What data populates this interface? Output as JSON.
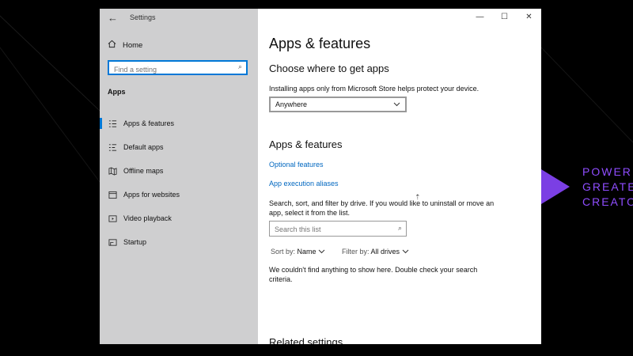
{
  "promo": {
    "text": "POWERI\nGREATE\nCREATO",
    "color": "#8f4dff"
  },
  "window": {
    "title": "Settings",
    "controls": {
      "minimize": "—",
      "maximize": "☐",
      "close": "✕"
    }
  },
  "sidebar": {
    "home": "Home",
    "search_placeholder": "Find a setting",
    "section": "Apps",
    "items": [
      {
        "label": "Apps & features",
        "icon": "apps-features-icon",
        "active": true
      },
      {
        "label": "Default apps",
        "icon": "default-apps-icon",
        "active": false
      },
      {
        "label": "Offline maps",
        "icon": "offline-maps-icon",
        "active": false
      },
      {
        "label": "Apps for websites",
        "icon": "apps-websites-icon",
        "active": false
      },
      {
        "label": "Video playback",
        "icon": "video-playback-icon",
        "active": false
      },
      {
        "label": "Startup",
        "icon": "startup-icon",
        "active": false
      }
    ]
  },
  "main": {
    "title": "Apps & features",
    "choose_heading": "Choose where to get apps",
    "choose_desc": "Installing apps only from Microsoft Store helps protect your device.",
    "source_value": "Anywhere",
    "apps_heading": "Apps & features",
    "link_optional": "Optional features",
    "link_aliases": "App execution aliases",
    "search_desc": "Search, sort, and filter by drive. If you would like to uninstall or move an app, select it from the list.",
    "search_placeholder": "Search this list",
    "sort_label": "Sort by:",
    "sort_value": "Name",
    "filter_label": "Filter by:",
    "filter_value": "All drives",
    "empty_msg": "We couldn't find anything to show here. Double check your search criteria.",
    "related_heading": "Related settings"
  }
}
